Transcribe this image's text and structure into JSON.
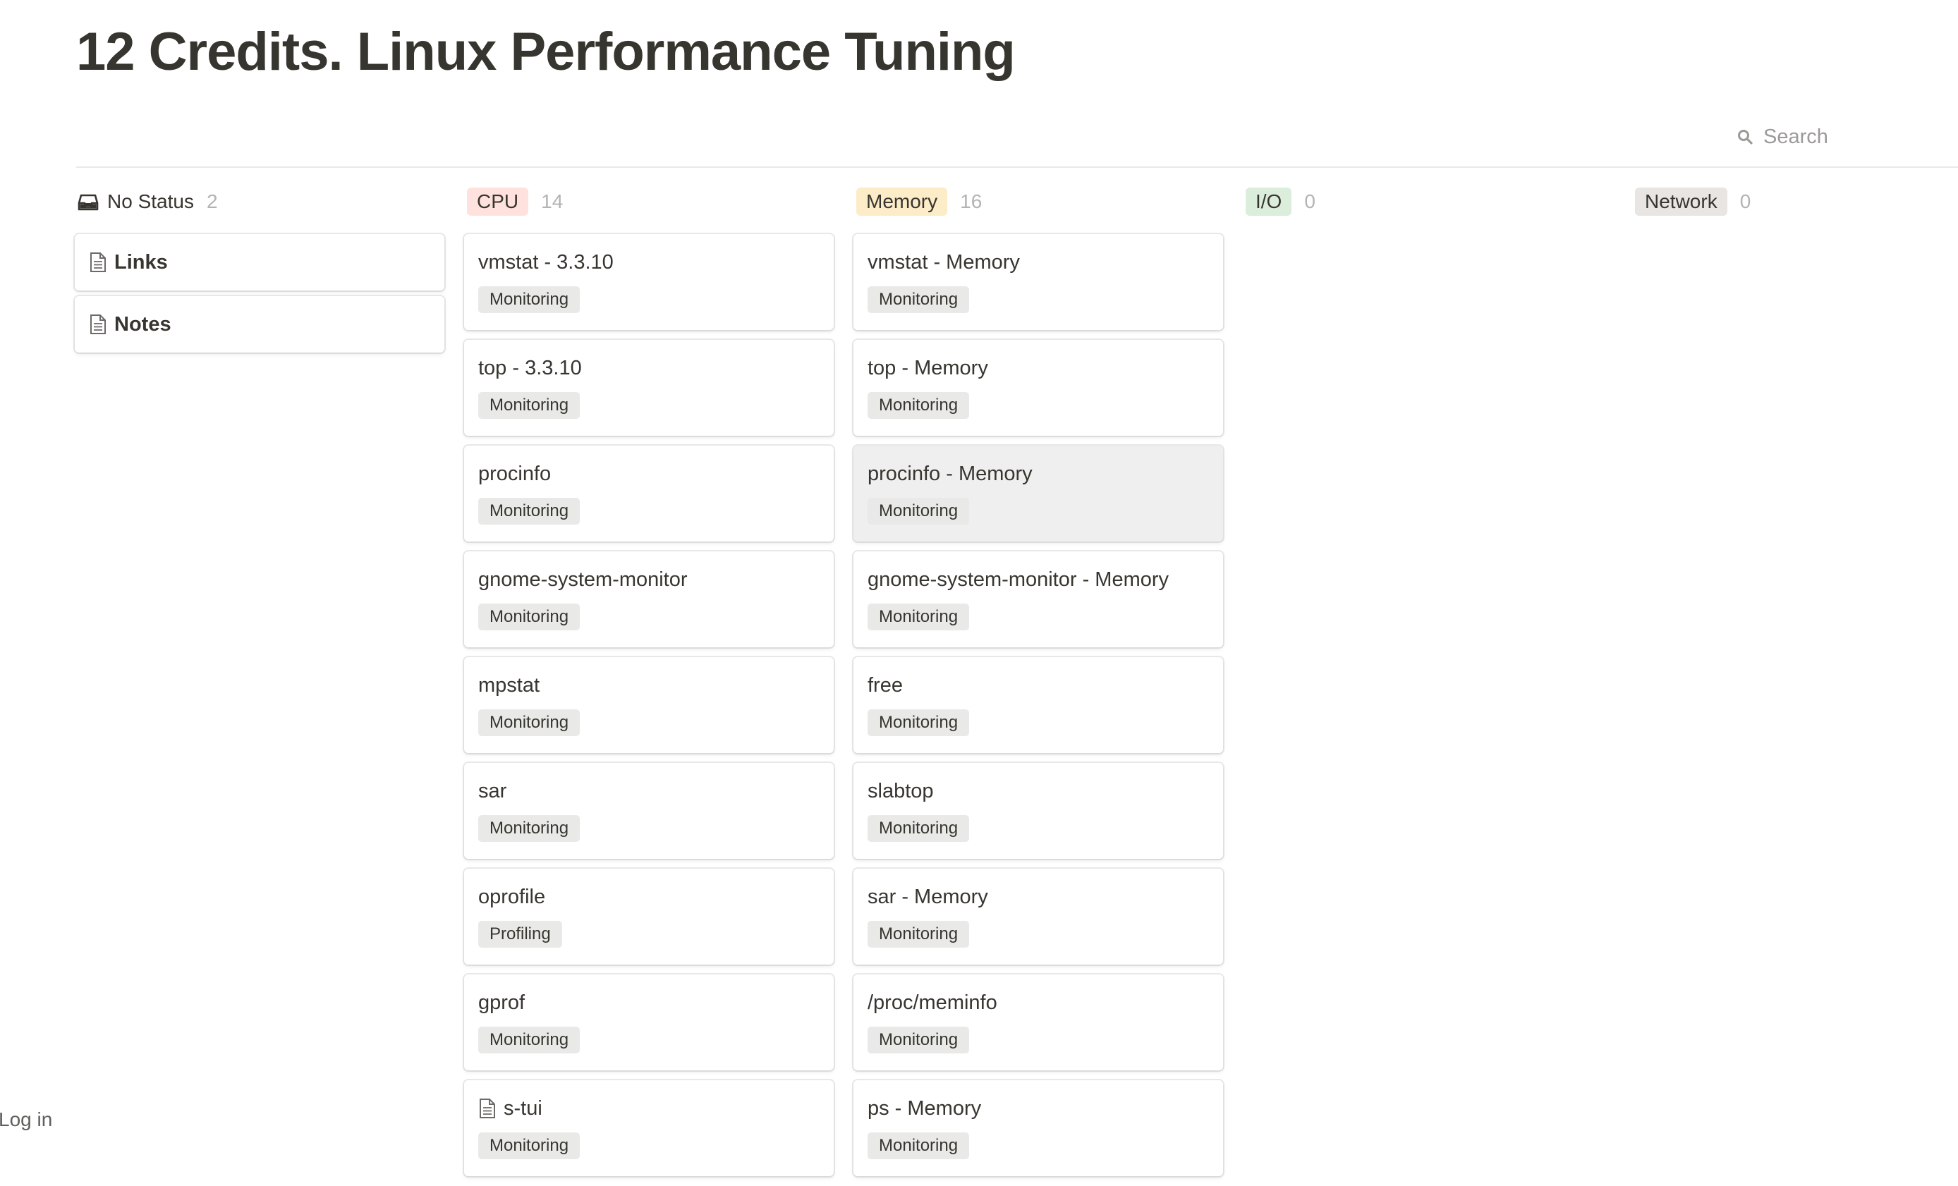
{
  "page": {
    "title": "12 Credits. Linux Performance Tuning"
  },
  "search": {
    "label": "Search"
  },
  "footer": {
    "login_label": "Log in"
  },
  "colors": {
    "cpu_pill": "#ffe2dd",
    "memory_pill": "#fdecc8",
    "io_pill": "#dbeddb",
    "network_pill": "#e9e5e3",
    "tag_bg": "#e9e9e7",
    "text": "#37352f"
  },
  "columns": [
    {
      "label": "No Status",
      "count": "2",
      "icon": "inbox-icon",
      "cards": [
        {
          "title": "Links",
          "icon": "page-icon"
        },
        {
          "title": "Notes",
          "icon": "page-icon"
        }
      ]
    },
    {
      "label": "CPU",
      "count": "14",
      "cards": [
        {
          "title": "vmstat - 3.3.10",
          "tag": "Monitoring"
        },
        {
          "title": "top - 3.3.10",
          "tag": "Monitoring"
        },
        {
          "title": "procinfo",
          "tag": "Monitoring"
        },
        {
          "title": "gnome-system-monitor",
          "tag": "Monitoring"
        },
        {
          "title": "mpstat",
          "tag": "Monitoring"
        },
        {
          "title": "sar",
          "tag": "Monitoring"
        },
        {
          "title": "oprofile",
          "tag": "Profiling"
        },
        {
          "title": "gprof",
          "tag": "Monitoring"
        },
        {
          "title": "s-tui",
          "tag": "Monitoring",
          "icon": "page-icon"
        }
      ]
    },
    {
      "label": "Memory",
      "count": "16",
      "cards": [
        {
          "title": "vmstat - Memory",
          "tag": "Monitoring"
        },
        {
          "title": "top - Memory",
          "tag": "Monitoring"
        },
        {
          "title": "procinfo - Memory",
          "tag": "Monitoring",
          "hovered": true
        },
        {
          "title": "gnome-system-monitor - Memory",
          "tag": "Monitoring"
        },
        {
          "title": "free",
          "tag": "Monitoring"
        },
        {
          "title": "slabtop",
          "tag": "Monitoring"
        },
        {
          "title": "sar - Memory",
          "tag": "Monitoring"
        },
        {
          "title": "/proc/meminfo",
          "tag": "Monitoring"
        },
        {
          "title": "ps - Memory",
          "tag": "Monitoring"
        }
      ]
    },
    {
      "label": "I/O",
      "count": "0",
      "cards": []
    },
    {
      "label": "Network",
      "count": "0",
      "cards": []
    }
  ]
}
